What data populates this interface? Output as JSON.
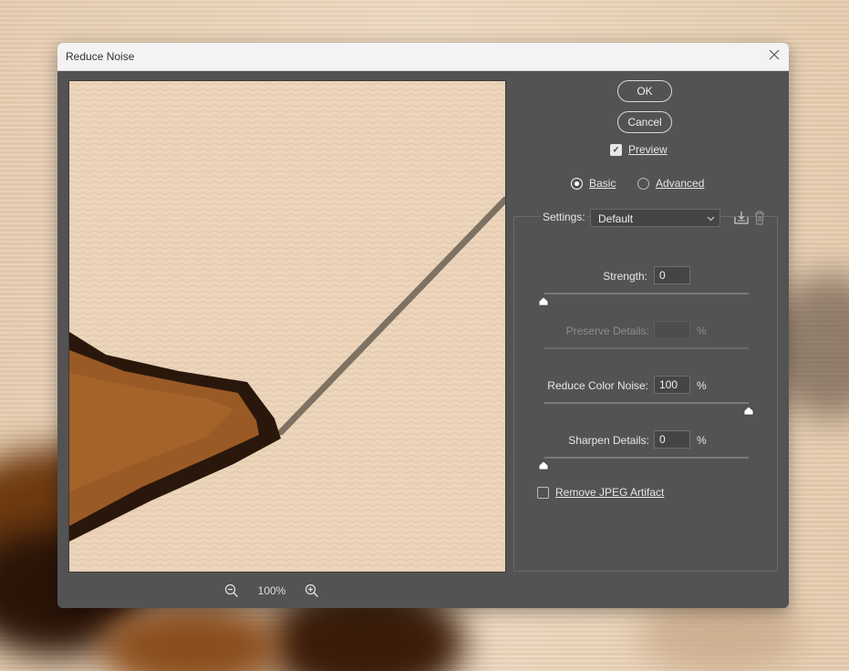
{
  "window": {
    "title": "Reduce Noise",
    "close_label": "✕"
  },
  "buttons": {
    "ok": "OK",
    "cancel": "Cancel"
  },
  "preview_checkbox": {
    "label": "Preview",
    "checked": true
  },
  "mode": {
    "basic": "Basic",
    "advanced": "Advanced",
    "selected": "basic"
  },
  "settings": {
    "label": "Settings:",
    "value": "Default"
  },
  "fields": {
    "strength": {
      "label": "Strength:",
      "value": "0",
      "level": 0
    },
    "preserve_details": {
      "label": "Preserve Details:",
      "value": "",
      "unit": "%",
      "enabled": false
    },
    "reduce_color_noise": {
      "label": "Reduce Color Noise:",
      "value": "100",
      "unit": "%",
      "level": 100
    },
    "sharpen_details": {
      "label": "Sharpen Details:",
      "value": "0",
      "unit": "%",
      "level": 0
    }
  },
  "remove_jpeg": {
    "label": "Remove JPEG Artifact",
    "checked": false
  },
  "zoom": {
    "level": "100%"
  },
  "icons": [
    "close-icon",
    "zoom-out-icon",
    "zoom-in-icon",
    "save-preset-icon",
    "delete-preset-icon",
    "checkmark-icon",
    "dropdown-arrow-icon",
    "slider-thumb-icon"
  ]
}
